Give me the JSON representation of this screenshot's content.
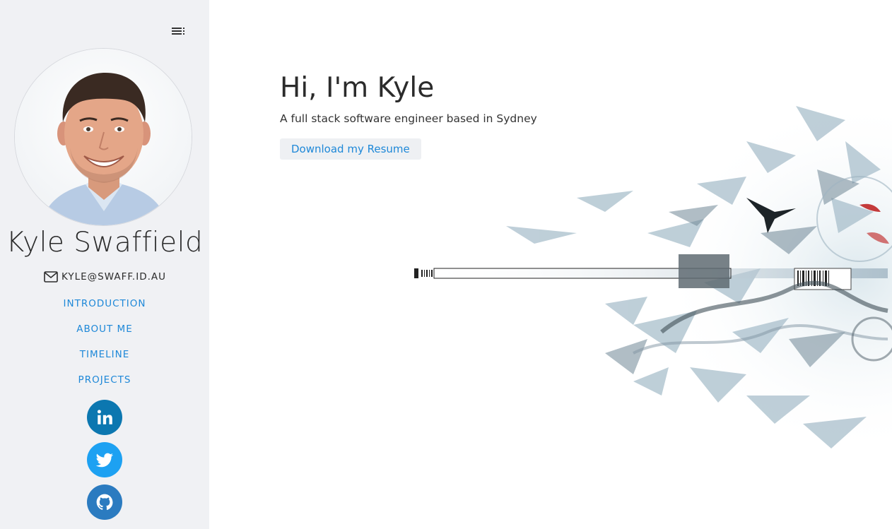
{
  "profile": {
    "name": "Kyle Swaffield",
    "email": "KYLE@SWAFF.ID.AU"
  },
  "nav": {
    "items": [
      {
        "label": "INTRODUCTION"
      },
      {
        "label": "ABOUT ME"
      },
      {
        "label": "TIMELINE"
      },
      {
        "label": "PROJECTS"
      }
    ]
  },
  "social": {
    "linkedin": {
      "icon": "linkedin-icon",
      "color": "#0c77b0"
    },
    "twitter": {
      "icon": "twitter-icon",
      "color": "#1da1f2"
    },
    "github": {
      "icon": "github-icon",
      "color": "#2b7bc0"
    }
  },
  "hero": {
    "headline": "Hi, I'm Kyle",
    "tagline": "A full stack software engineer based in Sydney",
    "resume_button": "Download my Resume"
  },
  "colors": {
    "accent": "#1e88d8",
    "sidebar_bg": "#f0f1f4",
    "text": "#2b2b2b"
  }
}
